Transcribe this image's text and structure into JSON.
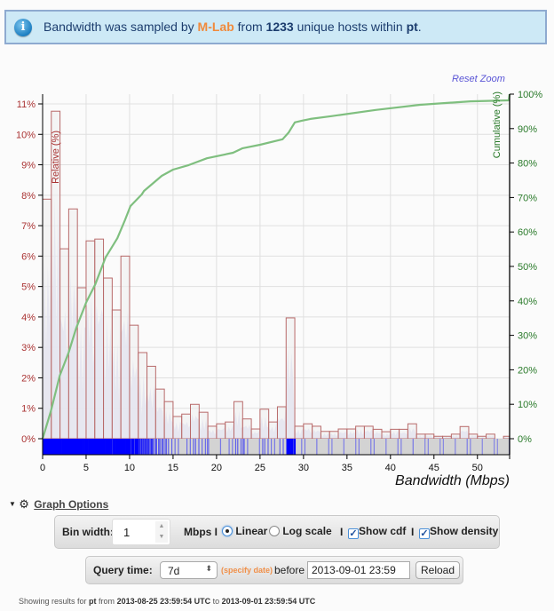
{
  "banner": {
    "prefix": "Bandwidth was sampled by ",
    "source": "M-Lab",
    "mid": " from ",
    "host_count": "1233",
    "suffix1": " unique hosts within ",
    "region": "pt",
    "suffix2": ".",
    "icon": "info-icon"
  },
  "chart": {
    "reset_zoom": "Reset Zoom"
  },
  "chart_data": {
    "type": "bar",
    "title": "",
    "xlabel": "Bandwidth (Mbps)",
    "ylabel_left": "Relative (%)",
    "ylabel_right": "Cumulative (%)",
    "xlim": [
      0,
      53.7
    ],
    "ylim_left": [
      0,
      11
    ],
    "ylim_right": [
      0,
      100
    ],
    "x_ticks": [
      "0",
      "5",
      "10",
      "15",
      "20",
      "25",
      "30",
      "35",
      "40",
      "45",
      "50"
    ],
    "y_ticks_left": [
      "0%",
      "1%",
      "2%",
      "3%",
      "4%",
      "5%",
      "6%",
      "7%",
      "8%",
      "9%",
      "10%",
      "11%"
    ],
    "y_ticks_right": [
      "0%",
      "10%",
      "20%",
      "30%",
      "40%",
      "50%",
      "60%",
      "70%",
      "80%",
      "90%",
      "100%"
    ],
    "grid": true,
    "bin_width": 1,
    "series": [
      {
        "name": "Relative (%)",
        "type": "bar",
        "color": "#b86a6a",
        "bins_start": 0,
        "values": [
          7.87,
          10.76,
          6.24,
          7.55,
          4.96,
          6.5,
          6.56,
          5.28,
          4.23,
          6.0,
          3.73,
          2.83,
          2.38,
          1.63,
          1.22,
          0.73,
          0.81,
          1.13,
          0.87,
          0.41,
          0.49,
          0.55,
          1.22,
          0.65,
          0.32,
          0.97,
          0.55,
          1.05,
          3.97,
          0.41,
          0.49,
          0.41,
          0.24,
          0.24,
          0.32,
          0.32,
          0.41,
          0.41,
          0.31,
          0.23,
          0.31,
          0.31,
          0.49,
          0.15,
          0.15,
          0.08,
          0.08,
          0.15,
          0.4,
          0.15,
          0.08,
          0.15,
          0,
          0.08
        ]
      },
      {
        "name": "Cumulative (%)",
        "type": "line",
        "color": "#7fbf7f",
        "x": [
          0,
          0.95,
          1.97,
          2.99,
          3.85,
          5.03,
          6.05,
          7.24,
          8.6,
          9.46,
          10.1,
          11.4,
          11.66,
          13.7,
          15.0,
          16.8,
          18.9,
          21.9,
          23.0,
          25.0,
          27.6,
          28.3,
          29.0,
          29.8,
          30.8,
          33.2,
          38.3,
          43.4,
          49.2,
          53.6,
          53.7
        ],
        "y": [
          0,
          8.0,
          18.3,
          25.0,
          32.0,
          39.7,
          44.8,
          52.6,
          58.2,
          63.4,
          67.5,
          70.9,
          71.9,
          76.3,
          78.1,
          79.4,
          81.4,
          83.0,
          84.3,
          85.3,
          86.9,
          88.9,
          91.8,
          92.3,
          92.8,
          93.6,
          95.4,
          96.9,
          97.9,
          98.2,
          100
        ]
      }
    ],
    "rug_color": "#0000ff",
    "density_color": "#d8d8f0"
  },
  "options": {
    "toggle_label": "Graph Options",
    "bin_width_label": "Bin width:",
    "bin_width_value": "1",
    "unit_label": "Mbps I",
    "linear_label": "Linear",
    "log_label": "Log scale",
    "sep": "I",
    "show_cdf_label": "Show cdf",
    "show_density_label": "Show density",
    "linear_selected": true,
    "show_cdf": true,
    "show_density": true
  },
  "query": {
    "label": "Query time:",
    "period": "7d",
    "specify_date": "(specify date)",
    "before": "before",
    "date_value": "2013-09-01 23:59",
    "reload": "Reload"
  },
  "footer": {
    "prefix": "Showing results for ",
    "region": "pt",
    "from": " from ",
    "start": "2013-08-25 23:59:54 UTC",
    "to": " to ",
    "end": "2013-09-01 23:59:54 UTC"
  }
}
